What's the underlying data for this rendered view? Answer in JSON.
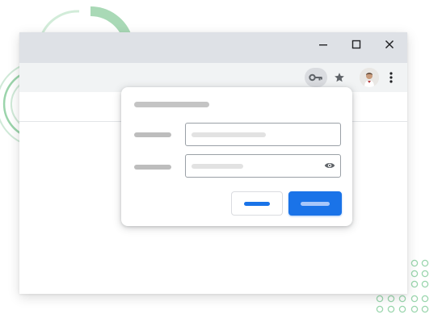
{
  "window": {
    "controls": {
      "minimize_icon": "minimize-icon",
      "maximize_icon": "maximize-icon",
      "close_icon": "close-icon"
    }
  },
  "toolbar": {
    "icons": [
      "key-icon",
      "star-icon",
      "avatar",
      "more-vert-icon"
    ]
  },
  "password_dialog": {
    "title_placeholder": "",
    "username_label": "",
    "username_value": "",
    "password_label": "",
    "password_value": "",
    "cancel_label": "",
    "save_label": "",
    "eye_icon": "eye-icon"
  },
  "colors": {
    "accent_blue": "#1a73e8",
    "title_bar": "#dee1e6",
    "toolbar": "#f1f3f4",
    "decor_green": "#8fd3a4",
    "skeleton_gray": "#bdbdbd",
    "skeleton_light": "#e2e2e2"
  }
}
